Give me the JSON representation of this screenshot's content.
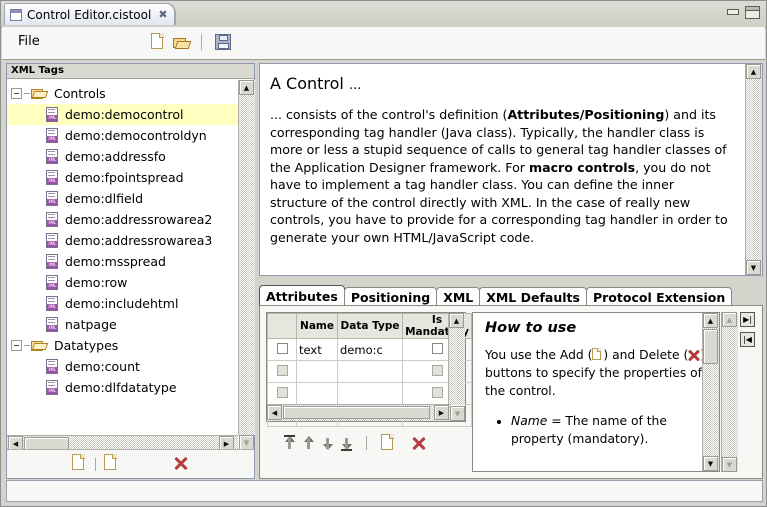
{
  "window": {
    "tab_title": "Control Editor.cistool",
    "tab_close": "✖",
    "minimize": "minimize",
    "maximize": "maximize"
  },
  "menubar": {
    "file_label": "File",
    "icons": [
      "new-file-icon",
      "open-folder-icon",
      "save-icon"
    ]
  },
  "left_panel": {
    "header": "XML Tags",
    "tree": [
      {
        "label": "Controls",
        "type": "folder",
        "level": 0,
        "selected": false
      },
      {
        "label": "demo:democontrol",
        "type": "xml",
        "level": 1,
        "selected": true
      },
      {
        "label": "demo:democontroldyn",
        "type": "xml",
        "level": 1,
        "selected": false
      },
      {
        "label": "demo:addressfo",
        "type": "xml",
        "level": 1,
        "selected": false
      },
      {
        "label": "demo:fpointspread",
        "type": "xml",
        "level": 1,
        "selected": false
      },
      {
        "label": "demo:dlfield",
        "type": "xml",
        "level": 1,
        "selected": false
      },
      {
        "label": "demo:addressrowarea2",
        "type": "xml",
        "level": 1,
        "selected": false
      },
      {
        "label": "demo:addressrowarea3",
        "type": "xml",
        "level": 1,
        "selected": false
      },
      {
        "label": "demo:msspread",
        "type": "xml",
        "level": 1,
        "selected": false
      },
      {
        "label": "demo:row",
        "type": "xml",
        "level": 1,
        "selected": false
      },
      {
        "label": "demo:includehtml",
        "type": "xml",
        "level": 1,
        "selected": false
      },
      {
        "label": "natpage",
        "type": "xml",
        "level": 1,
        "selected": false
      },
      {
        "label": "Datatypes",
        "type": "folder",
        "level": 0,
        "selected": false
      },
      {
        "label": "demo:count",
        "type": "xml",
        "level": 1,
        "selected": false
      },
      {
        "label": "demo:dlfdatatype",
        "type": "xml",
        "level": 1,
        "selected": false
      }
    ],
    "toolbar": [
      "new-tag-icon",
      "new-datatype-icon",
      "delete-icon"
    ]
  },
  "description": {
    "heading": "A Control",
    "heading_dots": "...",
    "paragraph_parts": [
      "... consists of the control's definition (",
      "Attributes/Positioning",
      ") and its corresponding tag handler (Java class). Typically, the handler class is more or less a stupid sequence of calls to general tag handler classes of the Application Designer framework. For ",
      "macro controls",
      ", you do not have to implement a tag handler class. You can define the inner structure of the control directly with XML. In the case of really new controls, you have to provide for a corresponding tag handler in order to generate your own HTML/JavaScript code."
    ]
  },
  "tabs": [
    {
      "label": "Attributes",
      "active": true
    },
    {
      "label": "Positioning",
      "active": false
    },
    {
      "label": "XML",
      "active": false
    },
    {
      "label": "XML Defaults",
      "active": false
    },
    {
      "label": "Protocol Extension",
      "active": false
    }
  ],
  "grid": {
    "columns": [
      "",
      "Name",
      "Data Type",
      "Is Mandatory"
    ],
    "rows": [
      {
        "check": false,
        "enabled": true,
        "name": "text",
        "datatype": "demo:c",
        "mandatory": false
      },
      {
        "check": false,
        "enabled": false,
        "name": "",
        "datatype": "",
        "mandatory": false
      },
      {
        "check": false,
        "enabled": false,
        "name": "",
        "datatype": "",
        "mandatory": false
      },
      {
        "check": false,
        "enabled": false,
        "name": "",
        "datatype": "",
        "mandatory": false
      }
    ],
    "toolbar": [
      "move-top-icon",
      "move-up-icon",
      "move-down-icon",
      "move-bottom-icon",
      "separator",
      "add-icon",
      "delete-icon"
    ]
  },
  "howto": {
    "title": "How to use",
    "intro_a": "You use the Add (",
    "intro_b": ") and Delete (",
    "intro_c": ") buttons to specify the properties of the control.",
    "bullets": [
      {
        "term": "Name",
        "text": " = The name of the property (mandatory)."
      }
    ]
  },
  "colors": {
    "selection": "#ffffc0",
    "panel_bg": "#d4d4cc",
    "accent_red": "#b43c3c",
    "folder_yellow": "#f7dfa0"
  }
}
